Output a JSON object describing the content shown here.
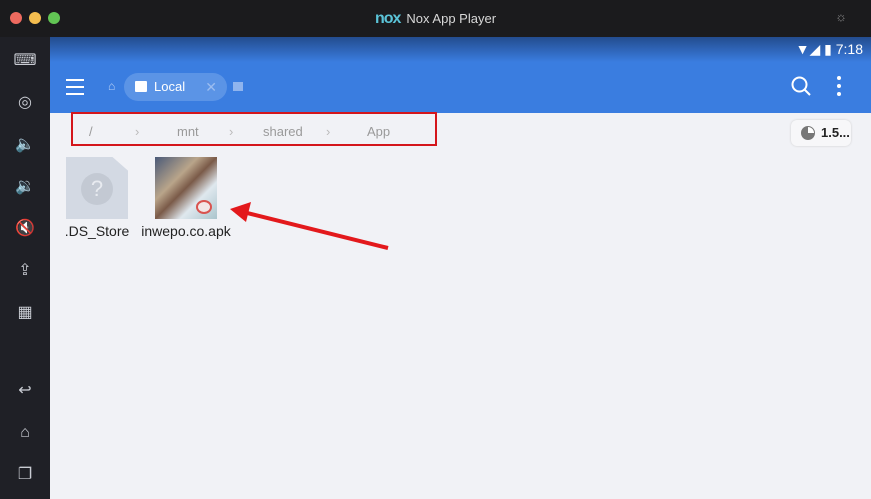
{
  "window": {
    "title": "Nox App Player",
    "logo_text": "nox"
  },
  "status": {
    "time": "7:18"
  },
  "toolbar": {
    "tab_label": "Local",
    "close_glyph": "✕"
  },
  "breadcrumb": [
    "/",
    "mnt",
    "shared",
    "App"
  ],
  "storage": {
    "label": "1.5..."
  },
  "files": [
    {
      "name": ".DS_Store",
      "icon": "unknown-file-icon"
    },
    {
      "name": "inwepo.co.apk",
      "icon": "apk-thumbnail"
    }
  ],
  "sidebar_icons": [
    "keyboard-icon",
    "location-icon",
    "volume-up-icon",
    "volume-down-icon",
    "mute-icon",
    "apk-install-icon",
    "screen-record-icon",
    "back-icon",
    "home-icon",
    "recents-icon"
  ],
  "colors": {
    "accent": "#3a7de0",
    "highlight": "#d4161c"
  }
}
